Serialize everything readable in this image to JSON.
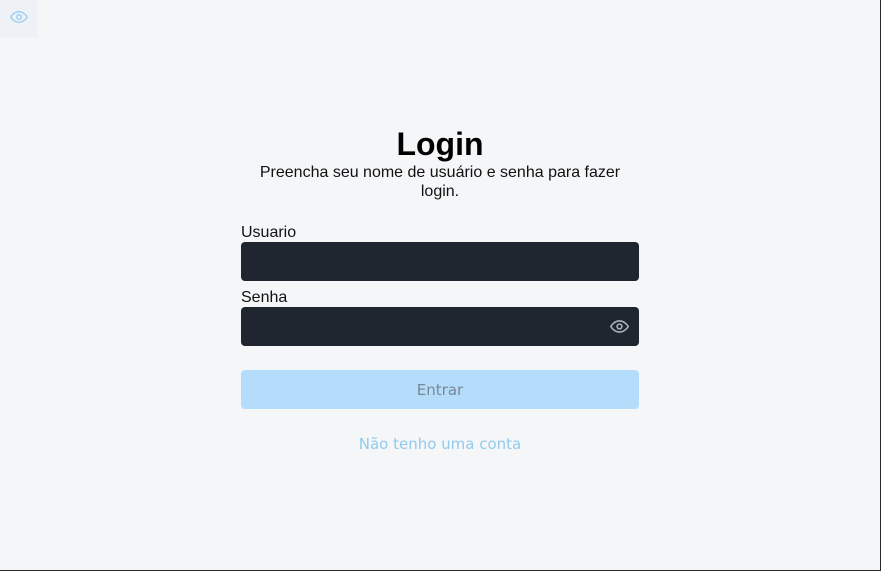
{
  "login": {
    "title": "Login",
    "subtitle": "Preencha seu nome de usuário e senha para fazer login.",
    "username_label": "Usuario",
    "username_value": "",
    "password_label": "Senha",
    "password_value": "",
    "submit_label": "Entrar",
    "signup_link": "Não tenho uma conta"
  },
  "icons": {
    "corner_toggle": "eye-icon",
    "password_toggle": "eye-icon"
  },
  "colors": {
    "background": "#f5f6f8",
    "input_background": "#1f2630",
    "button_background": "#b3ddfb",
    "button_text": "#7b8794",
    "link": "#91cbed",
    "corner_icon": "#9fd0f2"
  }
}
